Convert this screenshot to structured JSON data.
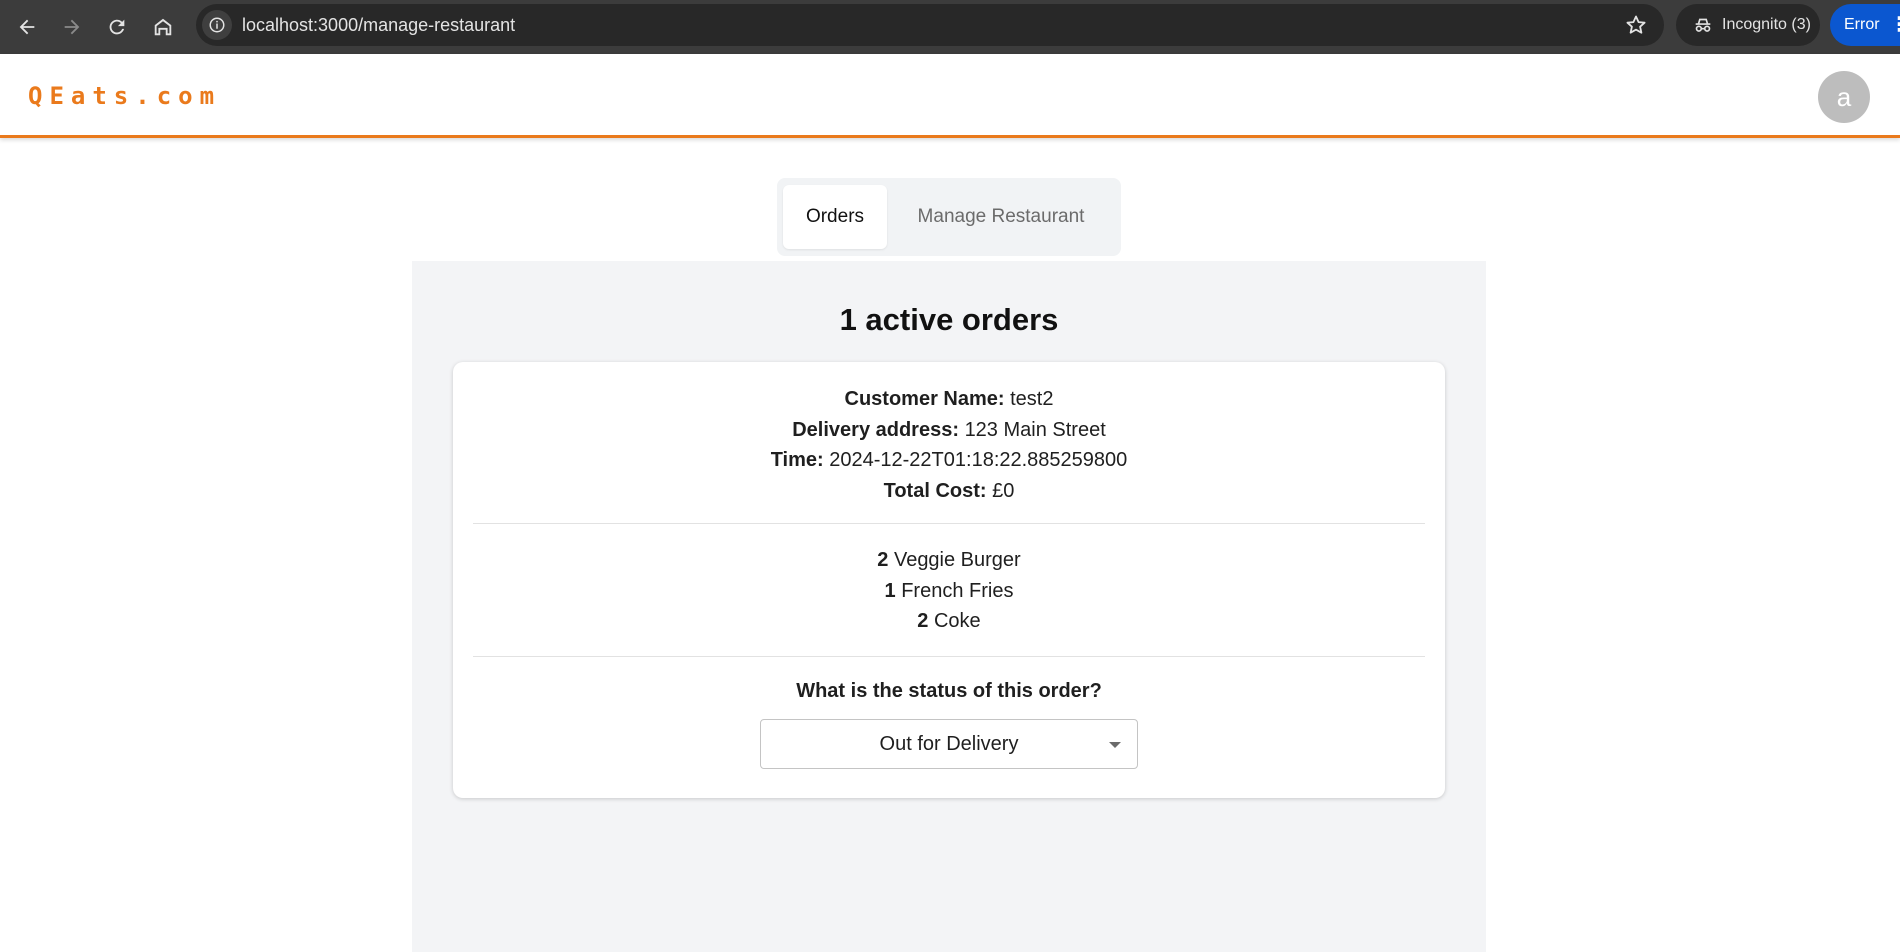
{
  "browser": {
    "url": "localhost:3000/manage-restaurant",
    "incognito_label": "Incognito (3)",
    "error_label": "Error"
  },
  "header": {
    "logo": "QEats.com",
    "avatar_initial": "a",
    "accent_color": "#ea7a1c"
  },
  "tabs": [
    {
      "label": "Orders",
      "active": true
    },
    {
      "label": "Manage Restaurant",
      "active": false
    }
  ],
  "orders": {
    "heading": "1 active orders",
    "list": [
      {
        "customer_label": "Customer Name:",
        "customer_name": "test2",
        "address_label": "Delivery address:",
        "address": "123 Main Street",
        "time_label": "Time:",
        "time": "2024-12-22T01:18:22.885259800",
        "cost_label": "Total Cost:",
        "cost": "£0",
        "items": [
          {
            "qty": "2",
            "name": "Veggie Burger"
          },
          {
            "qty": "1",
            "name": "French Fries"
          },
          {
            "qty": "2",
            "name": "Coke"
          }
        ],
        "status_question": "What is the status of this order?",
        "status_value": "Out for Delivery"
      }
    ]
  }
}
